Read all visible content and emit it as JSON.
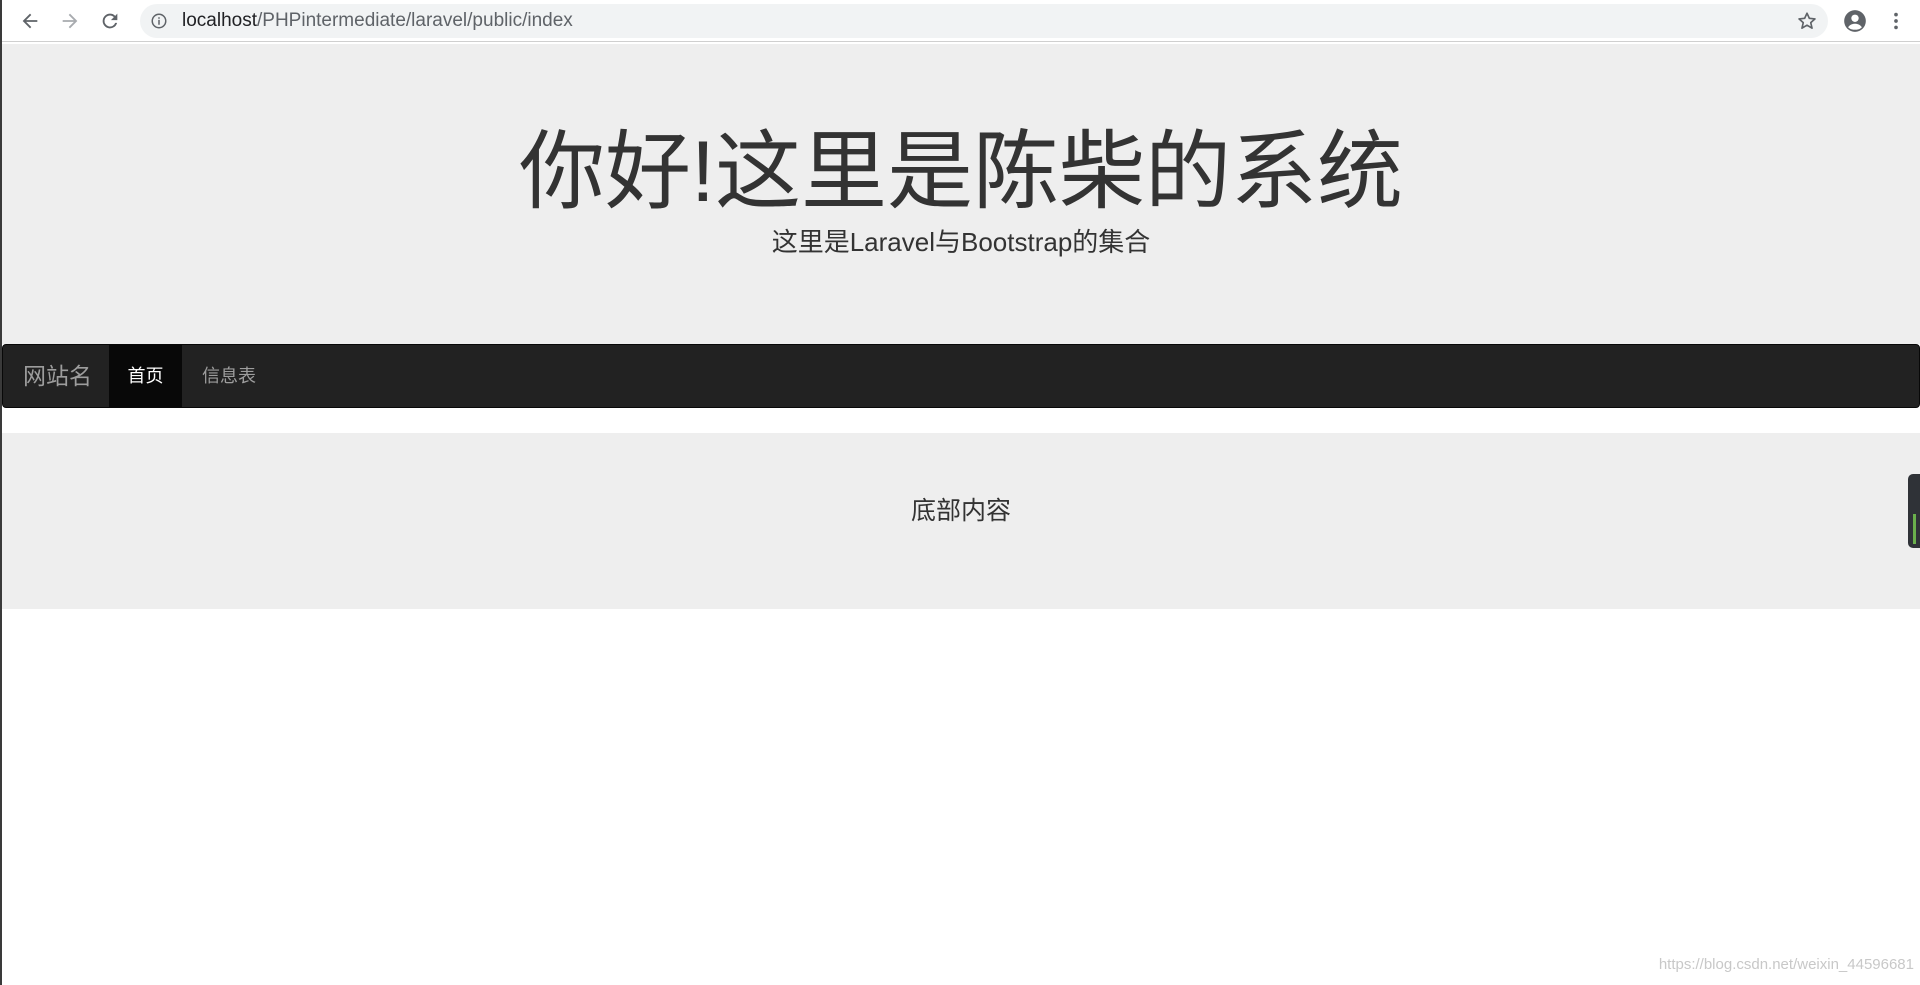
{
  "browser": {
    "url_host": "localhost",
    "url_path": "/PHPintermediate/laravel/public/index",
    "icons": [
      "back-icon",
      "forward-icon",
      "reload-icon",
      "info-icon",
      "star-icon",
      "account-icon",
      "more-icon"
    ]
  },
  "jumbotron": {
    "title": "你好!这里是陈柴的系统",
    "subtitle": "这里是Laravel与Bootstrap的集合",
    "background": "#eeeeee"
  },
  "navbar": {
    "brand": "网站名",
    "items": [
      {
        "label": "首页",
        "active": true
      },
      {
        "label": "信息表",
        "active": false
      }
    ],
    "background": "#222222"
  },
  "footer": {
    "text": "底部内容",
    "background": "#eeeeee"
  },
  "watermark": {
    "text": "https://blog.csdn.net/weixin_44596681"
  }
}
